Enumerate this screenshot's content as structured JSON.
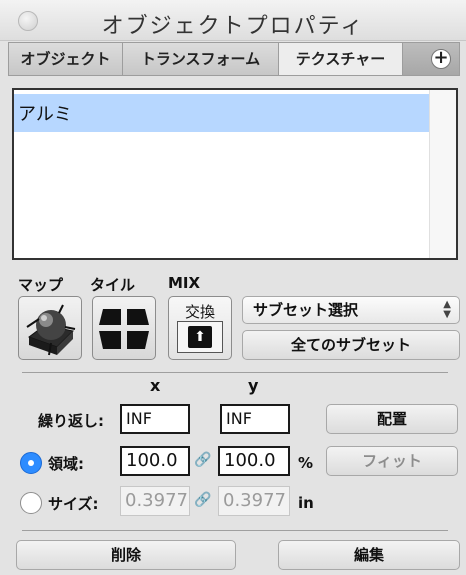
{
  "window": {
    "title": "オブジェクトプロパティ"
  },
  "tabs": [
    {
      "label": "オブジェクト",
      "active": false
    },
    {
      "label": "トランスフォーム",
      "active": false
    },
    {
      "label": "テクスチャー",
      "active": true
    }
  ],
  "tabs_extra": {
    "plus_label": "+"
  },
  "texture_list": {
    "items": [
      {
        "label": "アルミ",
        "selected": true
      }
    ]
  },
  "labels": {
    "map": "マップ",
    "tile": "タイル",
    "mix": "MIX"
  },
  "mix": {
    "swap_label": "交換",
    "icon_glyph": "⬆"
  },
  "subset": {
    "select_value": "サブセット選択",
    "all_subsets_button": "全てのサブセット"
  },
  "transform": {
    "x_label": "x",
    "y_label": "y",
    "repeat_label": "繰り返し:",
    "repeat_x": "INF",
    "repeat_y": "INF",
    "align_button": "配置",
    "area_label": "領域:",
    "area_x": "100.0",
    "area_y": "100.0",
    "area_unit": "%",
    "fit_button": "フィット",
    "size_label": "サイズ:",
    "size_x": "0.3977",
    "size_y": "0.3977",
    "size_unit": "in",
    "area_selected": true
  },
  "footer": {
    "delete_button": "削除",
    "edit_button": "編集"
  },
  "colors": {
    "selection": "#b7d7ff",
    "radio_accent": "#2d8cff"
  }
}
